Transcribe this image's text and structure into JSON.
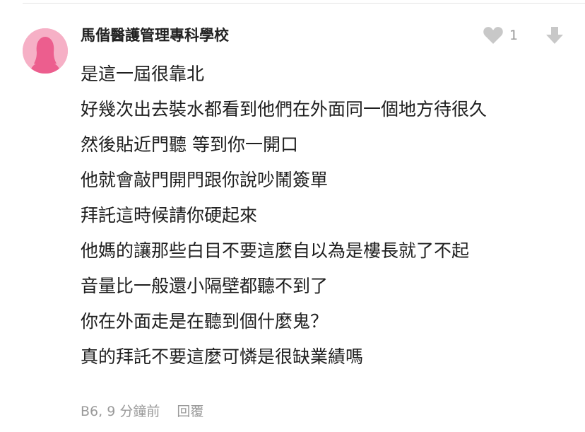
{
  "comment": {
    "author": "馬偕醫護管理專科學校",
    "avatar_icon": "female-silhouette-avatar",
    "avatar_color": "#f6b0c6",
    "likes": "1",
    "like_icon": "heart-icon",
    "dislike_icon": "arrow-down-icon",
    "lines": [
      "是這一屆很靠北",
      "好幾次出去裝水都看到他們在外面同一個地方待很久",
      "然後貼近門聽 等到你一開口",
      "他就會敲門開門跟你說吵鬧簽單",
      "拜託這時候請你硬起來",
      "他媽的讓那些白目不要這麼自以為是樓長就了不起",
      "音量比一般還小隔壁都聽不到了",
      "你在外面走是在聽到個什麼鬼？",
      "真的拜託不要這麼可憐是很缺業績嗎"
    ],
    "meta": "B6, 9 分鐘前",
    "reply_label": "回覆"
  }
}
